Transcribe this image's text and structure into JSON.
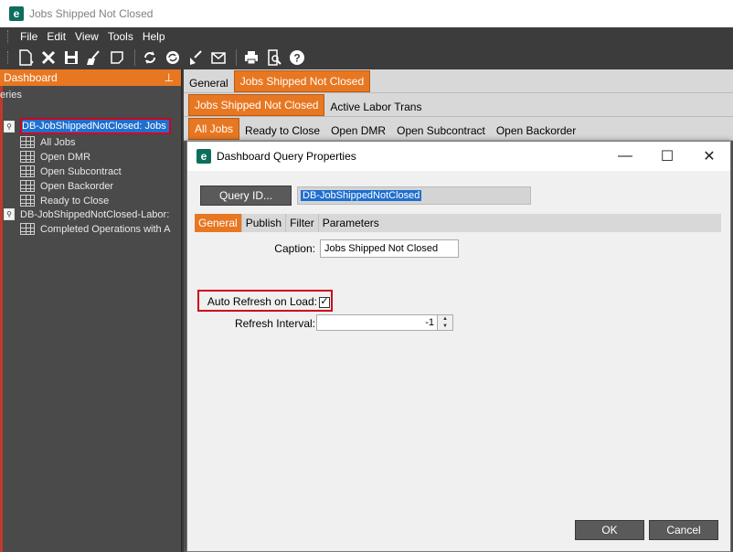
{
  "window": {
    "title": "Jobs Shipped Not Closed",
    "logo": "e"
  },
  "menu": [
    "File",
    "Edit",
    "View",
    "Tools",
    "Help"
  ],
  "toolbar": {
    "icons": [
      "new-icon",
      "delete-icon",
      "save-icon",
      "clear-icon",
      "blank-icon",
      "refresh-icon",
      "sync-icon",
      "broom-icon",
      "email-icon",
      "print-icon",
      "print-preview-icon",
      "help-icon"
    ]
  },
  "left_panel": {
    "header": "Dashboard",
    "pin": "⊥",
    "section": "eries",
    "tree": [
      {
        "label": "DB-JobShippedNotClosed: Jobs",
        "type": "query",
        "selected": true
      },
      {
        "label": "All Jobs",
        "type": "grid"
      },
      {
        "label": "Open DMR",
        "type": "grid"
      },
      {
        "label": "Open Subcontract",
        "type": "grid"
      },
      {
        "label": "Open Backorder",
        "type": "grid"
      },
      {
        "label": "Ready to Close",
        "type": "grid"
      },
      {
        "label": "DB-JobShippedNotClosed-Labor:",
        "type": "query"
      },
      {
        "label": "Completed Operations with A",
        "type": "grid"
      }
    ]
  },
  "main_tabs": {
    "row1": [
      "General",
      "Jobs Shipped Not Closed"
    ],
    "row2": [
      "Jobs Shipped Not Closed",
      "Active Labor Trans"
    ],
    "row3": [
      "All Jobs",
      "Ready to Close",
      "Open DMR",
      "Open Subcontract",
      "Open Backorder"
    ]
  },
  "dialog": {
    "title": "Dashboard Query Properties",
    "query_id_button": "Query ID...",
    "query_id_value": "DB-JobShippedNotClosed",
    "tabs": [
      "General",
      "Publish",
      "Filter",
      "Parameters"
    ],
    "caption_label": "Caption:",
    "caption_value": "Jobs Shipped Not Closed",
    "auto_refresh_label": "Auto Refresh on Load:",
    "auto_refresh_checked": true,
    "checkmark": "✓",
    "refresh_interval_label": "Refresh Interval:",
    "refresh_interval_value": "-1",
    "ok": "OK",
    "cancel": "Cancel",
    "minimize": "—",
    "maximize": "☐",
    "close": "✕"
  }
}
